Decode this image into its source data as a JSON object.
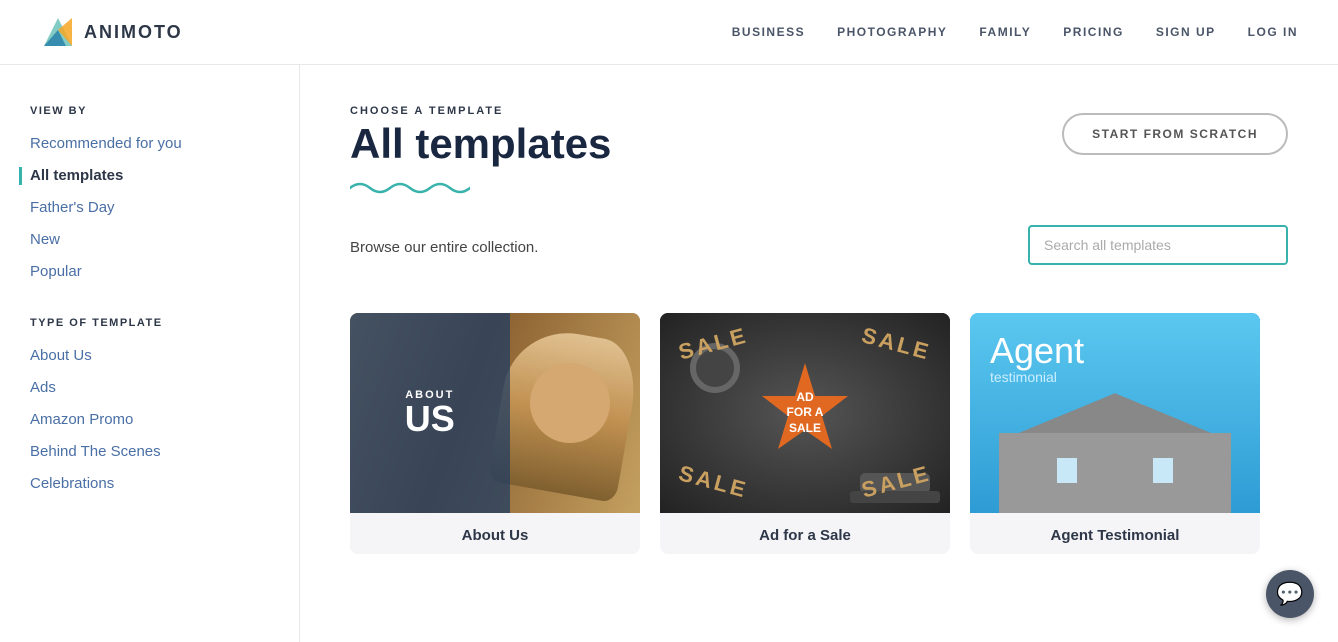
{
  "header": {
    "logo_text": "ANIMOTO",
    "nav": {
      "items": [
        {
          "label": "BUSINESS"
        },
        {
          "label": "PHOTOGRAPHY"
        },
        {
          "label": "FAMILY"
        },
        {
          "label": "PRICING"
        },
        {
          "label": "SIGN UP"
        },
        {
          "label": "LOG IN"
        }
      ]
    }
  },
  "sidebar": {
    "view_by_label": "VIEW BY",
    "type_of_template_label": "TYPE OF TEMPLATE",
    "view_by_items": [
      {
        "label": "Recommended for you",
        "active": false
      },
      {
        "label": "All templates",
        "active": true
      },
      {
        "label": "Father's Day",
        "active": false
      },
      {
        "label": "New",
        "active": false
      },
      {
        "label": "Popular",
        "active": false
      }
    ],
    "type_items": [
      {
        "label": "About Us",
        "active": false
      },
      {
        "label": "Ads",
        "active": false
      },
      {
        "label": "Amazon Promo",
        "active": false
      },
      {
        "label": "Behind The Scenes",
        "active": false
      },
      {
        "label": "Celebrations",
        "active": false
      }
    ]
  },
  "content": {
    "choose_label": "CHOOSE A TEMPLATE",
    "page_title": "All templates",
    "start_scratch_label": "START FROM SCRATCH",
    "wave": "∿∿∿∿∿",
    "browse_text": "Browse our entire collection.",
    "search_placeholder": "Search all templates",
    "cards": [
      {
        "label": "About Us",
        "type": "about_us"
      },
      {
        "label": "Ad for a Sale",
        "type": "ad_sale"
      },
      {
        "label": "Agent Testimonial",
        "type": "agent_testimonial"
      }
    ]
  },
  "chat_button": {
    "label": "💬"
  }
}
